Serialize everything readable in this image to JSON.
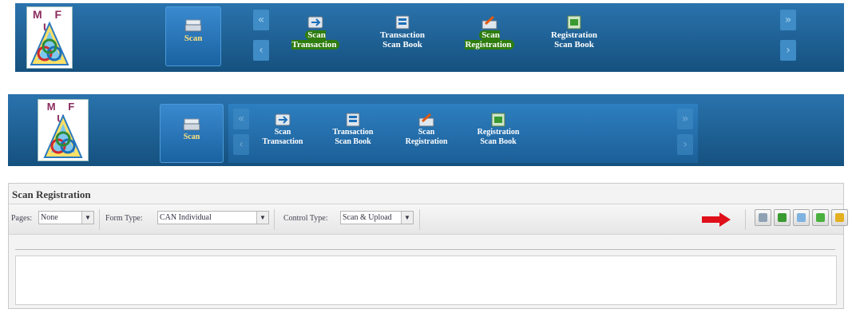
{
  "logo_text": "M F U",
  "nav1": {
    "scan": "Scan",
    "items": [
      {
        "l1": "Scan",
        "l2": "Transaction"
      },
      {
        "l1": "Transaction",
        "l2": "Scan Book"
      },
      {
        "l1": "Scan",
        "l2": "Registration"
      },
      {
        "l1": "Registration",
        "l2": "Scan Book"
      }
    ]
  },
  "nav2": {
    "scan": "Scan",
    "items": [
      {
        "l1": "Scan",
        "l2": "Transaction"
      },
      {
        "l1": "Transaction",
        "l2": "Scan Book"
      },
      {
        "l1": "Scan",
        "l2": "Registration"
      },
      {
        "l1": "Registration",
        "l2": "Scan Book"
      }
    ]
  },
  "panel": {
    "title": "Scan Registration",
    "pages_label": "Pages:",
    "pages_value": "None",
    "form_type_label": "Form Type:",
    "form_type_value": "CAN Individual",
    "control_type_label": "Control Type:",
    "control_type_value": "Scan & Upload"
  },
  "colors": {
    "accent": "#1f629a",
    "highlight": "#2e7d0e",
    "arrow": "#e0101a"
  },
  "icons": [
    "scanner-icon",
    "refresh-icon",
    "document-icon",
    "upload-icon",
    "add-icon"
  ]
}
